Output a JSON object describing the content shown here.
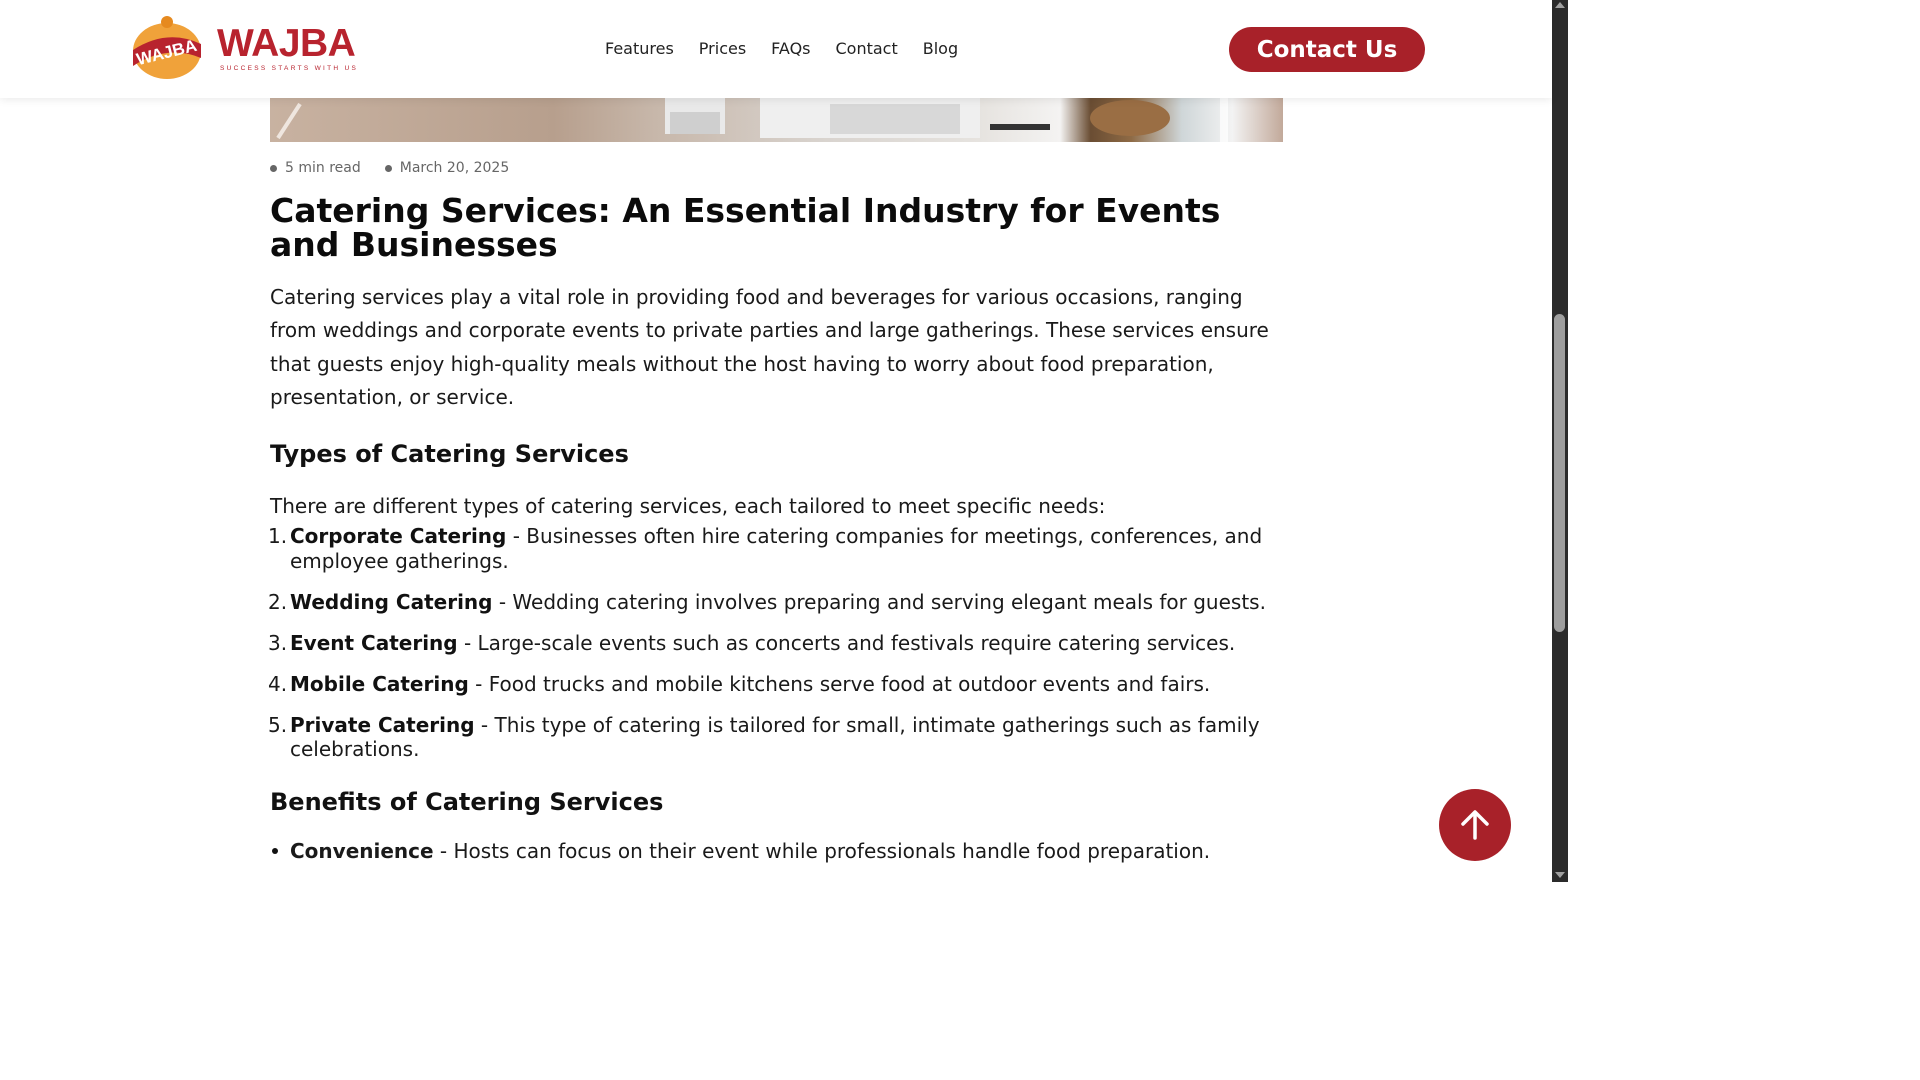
{
  "header": {
    "logo": {
      "badge_text": "WAJBA",
      "wordmark": "WAJBA",
      "tagline": "SUCCESS STARTS WITH US"
    },
    "nav": [
      "Features",
      "Prices",
      "FAQs",
      "Contact",
      "Blog"
    ],
    "cta_label": "Contact Us"
  },
  "article": {
    "meta": {
      "read_time": "5 min read",
      "date": "March 20, 2025"
    },
    "title": "Catering Services: An Essential Industry for Events and Businesses",
    "intro": "Catering services play a vital role in providing food and beverages for various occasions, ranging from weddings and corporate events to private parties and large gatherings. These services ensure that guests enjoy high-quality meals without the host having to worry about food preparation, presentation, or service.",
    "types_heading": "Types of Catering Services",
    "types_lead": "There are different types of catering services, each tailored to meet specific needs:",
    "types": [
      {
        "num": "1.",
        "name": "Corporate Catering",
        "desc": " - Businesses often hire catering companies for meetings, conferences, and employee gatherings."
      },
      {
        "num": "2.",
        "name": "Wedding Catering",
        "desc": " - Wedding catering involves preparing and serving elegant meals for guests."
      },
      {
        "num": "3.",
        "name": "Event Catering",
        "desc": " - Large-scale events such as concerts and festivals require catering services."
      },
      {
        "num": "4.",
        "name": "Mobile Catering",
        "desc": " - Food trucks and mobile kitchens serve food at outdoor events and fairs."
      },
      {
        "num": "5.",
        "name": "Private Catering",
        "desc": " - This type of catering is tailored for small, intimate gatherings such as family celebrations."
      }
    ],
    "benefits_heading": "Benefits of Catering Services",
    "benefits": [
      {
        "name": "Convenience",
        "desc": " - Hosts can focus on their event while professionals handle food preparation."
      }
    ]
  },
  "icons": {
    "back_to_top": "arrow-up-icon"
  },
  "colors": {
    "brand": "#a82129",
    "logo_orange": "#f0a23a"
  }
}
